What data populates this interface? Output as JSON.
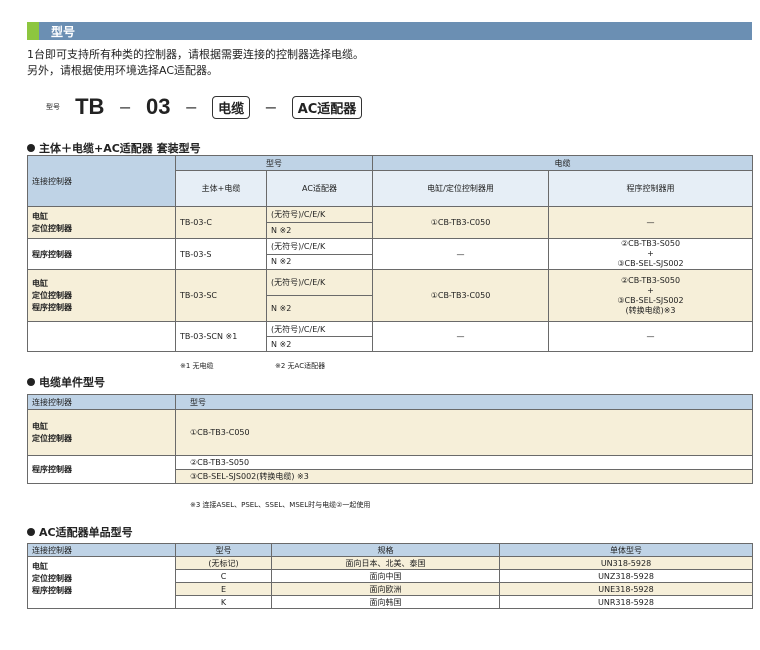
{
  "header": {
    "title": "型号"
  },
  "intro": {
    "line1": "1台即可支持所有种类的控制器，请根据需要连接的控制器选择电缆。",
    "line2": "另外，请根据使用环境选择AC适配器。"
  },
  "model_code": {
    "label": "型号",
    "p1": "TB",
    "dash": "−",
    "p2": "03",
    "p3": "电缆",
    "p4": "AC适配器"
  },
  "set": {
    "title": "主体＋电缆+AC适配器 套装型号",
    "h_conn": "连接控制器",
    "h_model": "型号",
    "h_cable": "电缆",
    "h_main": "主体+电缆",
    "h_ac": "AC适配器",
    "h_cyl": "电缸/定位控制器用",
    "h_prog": "程序控制器用",
    "r1_c1": "电缸",
    "r1_c2": "定位控制器",
    "r1_model": "TB-03-C",
    "r1_cyl": "①CB-TB3-C050",
    "r1_prog": "—",
    "r2_c1": "程序控制器",
    "r2_model": "TB-03-S",
    "r2_cyl": "—",
    "r2_p1": "②CB-TB3-S050",
    "r2_p2": "+",
    "r2_p3": "③CB-SEL-SJS002",
    "r3_c1": "电缸",
    "r3_c2": "定位控制器",
    "r3_c3": "程序控制器",
    "r3_model": "TB-03-SC",
    "r3_cyl": "①CB-TB3-C050",
    "r3_p1": "②CB-TB3-S050",
    "r3_p2": "+",
    "r3_p3": "③CB-SEL-SJS002",
    "r3_p4": "(转换电缆)※3",
    "r4_model": "TB-03-SCN ※1",
    "r4_cyl": "—",
    "r4_prog": "—",
    "ac_a": "(无符号)/C/E/K",
    "ac_b": "N ※2",
    "note1": "※1 无电缆",
    "note2": "※2 无AC适配器"
  },
  "cable": {
    "title": "电缆单件型号",
    "h_conn": "连接控制器",
    "h_model": "型号",
    "r1_c1": "电缸",
    "r1_c2": "定位控制器",
    "r1_model": "①CB-TB3-C050",
    "r2_c1": "程序控制器",
    "r2_m1": "②CB-TB3-S050",
    "r2_m2": "③CB-SEL-SJS002(转换电缆) ※3",
    "note3": "※3 连接ASEL、PSEL、SSEL、MSEL时与电缆②一起使用"
  },
  "ac": {
    "title": "AC适配器单品型号",
    "h_conn": "连接控制器",
    "h_model": "型号",
    "h_spec": "规格",
    "h_unit": "单体型号",
    "c1": "电缸",
    "c2": "定位控制器",
    "c3": "程序控制器",
    "rows": [
      {
        "model": "(无标记)",
        "spec": "面向日本、北美、泰国",
        "unit": "UN318-5928"
      },
      {
        "model": "C",
        "spec": "面向中国",
        "unit": "UNZ318-5928"
      },
      {
        "model": "E",
        "spec": "面向欧洲",
        "unit": "UNE318-5928"
      },
      {
        "model": "K",
        "spec": "面向韩国",
        "unit": "UNR318-5928"
      }
    ]
  }
}
